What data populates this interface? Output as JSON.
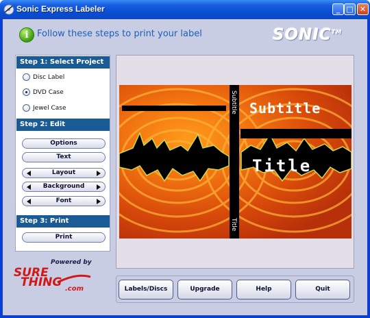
{
  "window": {
    "title": "Sonic Express Labeler",
    "controls": {
      "minimize": "_",
      "maximize": "□",
      "close": "✕"
    }
  },
  "header": {
    "info_glyph": "i",
    "instruction": "Follow these steps to print your label",
    "logo": "SONIC",
    "logo_tm": "TM"
  },
  "steps": {
    "step1": {
      "title": "Step 1: Select Project",
      "options": [
        {
          "label": "Disc Label",
          "checked": false
        },
        {
          "label": "DVD Case",
          "checked": true
        },
        {
          "label": "Jewel Case",
          "checked": false
        }
      ]
    },
    "step2": {
      "title": "Step 2: Edit",
      "buttons": {
        "options": "Options",
        "text": "Text",
        "layout": "Layout",
        "background": "Background",
        "font": "Font"
      }
    },
    "step3": {
      "title": "Step 3: Print",
      "button": "Print"
    }
  },
  "branding": {
    "powered_by": "Powered by",
    "line1": "SURE",
    "line2": "THING",
    "domain": ".com"
  },
  "preview": {
    "subtitle": "Subtitle",
    "title": "Title",
    "spine_top": "Subtitle",
    "spine_bottom": "Title"
  },
  "bottom_buttons": {
    "labels": "Labels/Discs",
    "upgrade": "Upgrade",
    "help": "Help",
    "quit": "Quit"
  },
  "colors": {
    "titlebar": "#0a4fd6",
    "client_bg": "#c9cde3",
    "step_header": "#1a5a95",
    "header_text": "#1c5fb8",
    "brand_red": "#d01818"
  },
  "icons": {
    "app": "app-disc-icon",
    "info": "info-icon",
    "arrows": [
      "left-arrow-icon",
      "right-arrow-icon"
    ]
  }
}
